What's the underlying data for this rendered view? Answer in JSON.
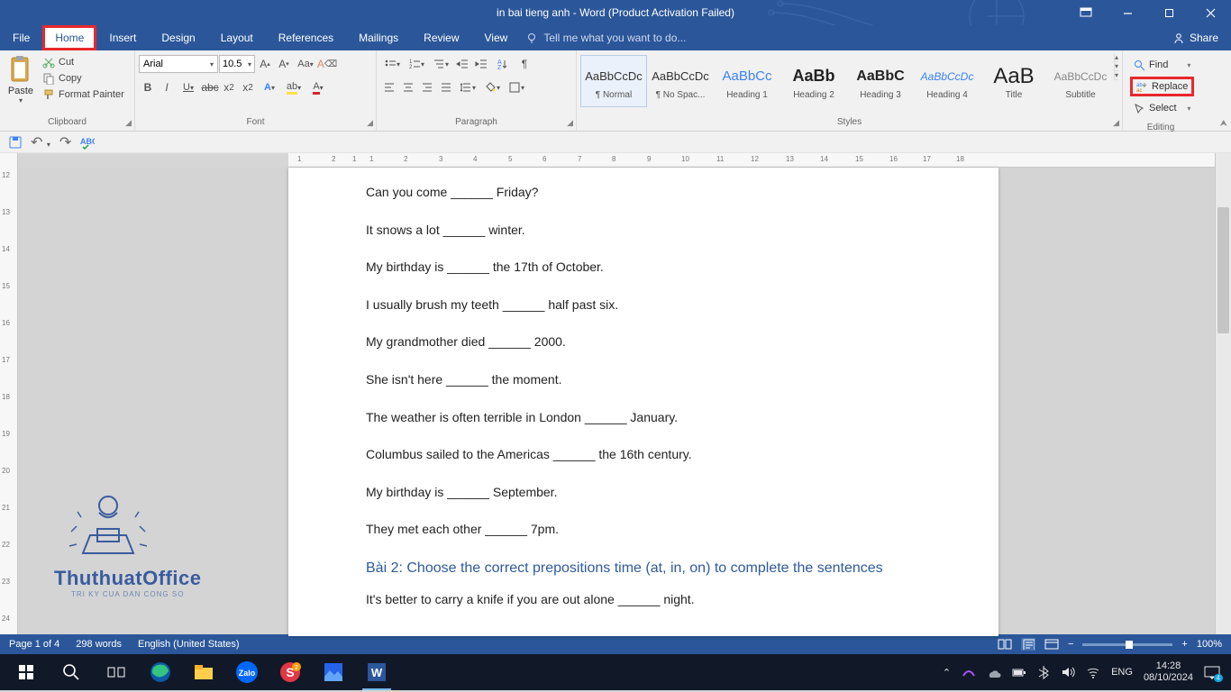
{
  "title": "in bai tieng anh - Word (Product Activation Failed)",
  "menu": [
    "File",
    "Home",
    "Insert",
    "Design",
    "Layout",
    "References",
    "Mailings",
    "Review",
    "View"
  ],
  "tellme": "Tell me what you want to do...",
  "share": "Share",
  "clipboard": {
    "paste": "Paste",
    "cut": "Cut",
    "copy": "Copy",
    "painter": "Format Painter",
    "label": "Clipboard"
  },
  "font": {
    "name": "Arial",
    "size": "10.5",
    "label": "Font"
  },
  "paragraph": {
    "label": "Paragraph"
  },
  "styles": {
    "label": "Styles",
    "items": [
      {
        "name": "¶ Normal",
        "preview": "AaBbCcDc",
        "cls": "n"
      },
      {
        "name": "¶ No Spac...",
        "preview": "AaBbCcDc",
        "cls": "n"
      },
      {
        "name": "Heading 1",
        "preview": "AaBbCc",
        "cls": "h1"
      },
      {
        "name": "Heading 2",
        "preview": "AaBb",
        "cls": "h2b"
      },
      {
        "name": "Heading 3",
        "preview": "AaBbC",
        "cls": "h3"
      },
      {
        "name": "Heading 4",
        "preview": "AaBbCcDc",
        "cls": "h4"
      },
      {
        "name": "Title",
        "preview": "AaB",
        "cls": "tt"
      },
      {
        "name": "Subtitle",
        "preview": "AaBbCcDc",
        "cls": "st"
      }
    ]
  },
  "editing": {
    "find": "Find",
    "replace": "Replace",
    "select": "Select",
    "label": "Editing"
  },
  "doc": {
    "lines": [
      "Can you come ______ Friday?",
      "It snows a lot ______ winter.",
      "My birthday is ______ the 17th of October.",
      "I usually brush my teeth ______ half past six.",
      "My grandmother died ______ 2000.",
      "She isn't here ______ the moment.",
      "The weather is often terrible in London ______ January.",
      "Columbus sailed to the Americas ______ the 16th century.",
      "My birthday is ______ September.",
      "They met each other ______ 7pm."
    ],
    "h2": "Bài 2: Choose the correct prepositions time (at, in, on) to complete the sentences",
    "line11": "It's better to carry a knife if you are out alone ______ night."
  },
  "ruler_h": [
    "1",
    "2",
    "1",
    "1",
    "2",
    "3",
    "4",
    "5",
    "6",
    "7",
    "8",
    "9",
    "10",
    "11",
    "12",
    "13",
    "14",
    "15",
    "16",
    "17",
    "18"
  ],
  "ruler_v": [
    "12",
    "13",
    "14",
    "15",
    "16",
    "17",
    "18",
    "19",
    "20",
    "21",
    "22",
    "23",
    "24"
  ],
  "status": {
    "page": "Page 1 of 4",
    "words": "298 words",
    "lang": "English (United States)",
    "zoom": "100%"
  },
  "watermark": {
    "name": "ThuthuatOffice",
    "tag": "TRI KY CUA DAN CONG SO"
  },
  "tray": {
    "lang": "ENG",
    "time": "14:28",
    "date": "08/10/2024",
    "count": "4"
  }
}
